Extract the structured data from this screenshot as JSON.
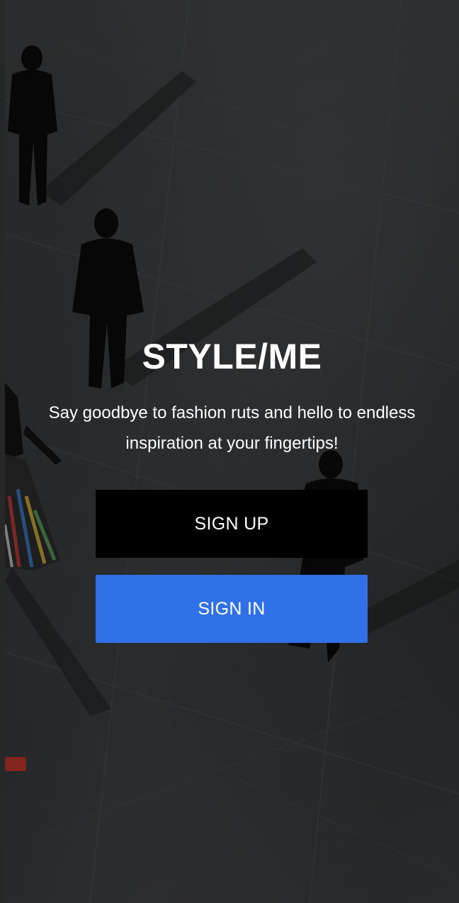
{
  "app": {
    "title": "STYLE/ME",
    "tagline": "Say goodbye to fashion ruts and hello to endless inspiration at your fingertips!"
  },
  "actions": {
    "signup_label": "SIGN UP",
    "signin_label": "SIGN IN"
  },
  "background": {
    "description_icon": "background-photo",
    "overlay_color": "#000000"
  },
  "colors": {
    "signup_button": "#000000",
    "signin_button": "#3071e8",
    "text": "#ffffff"
  }
}
